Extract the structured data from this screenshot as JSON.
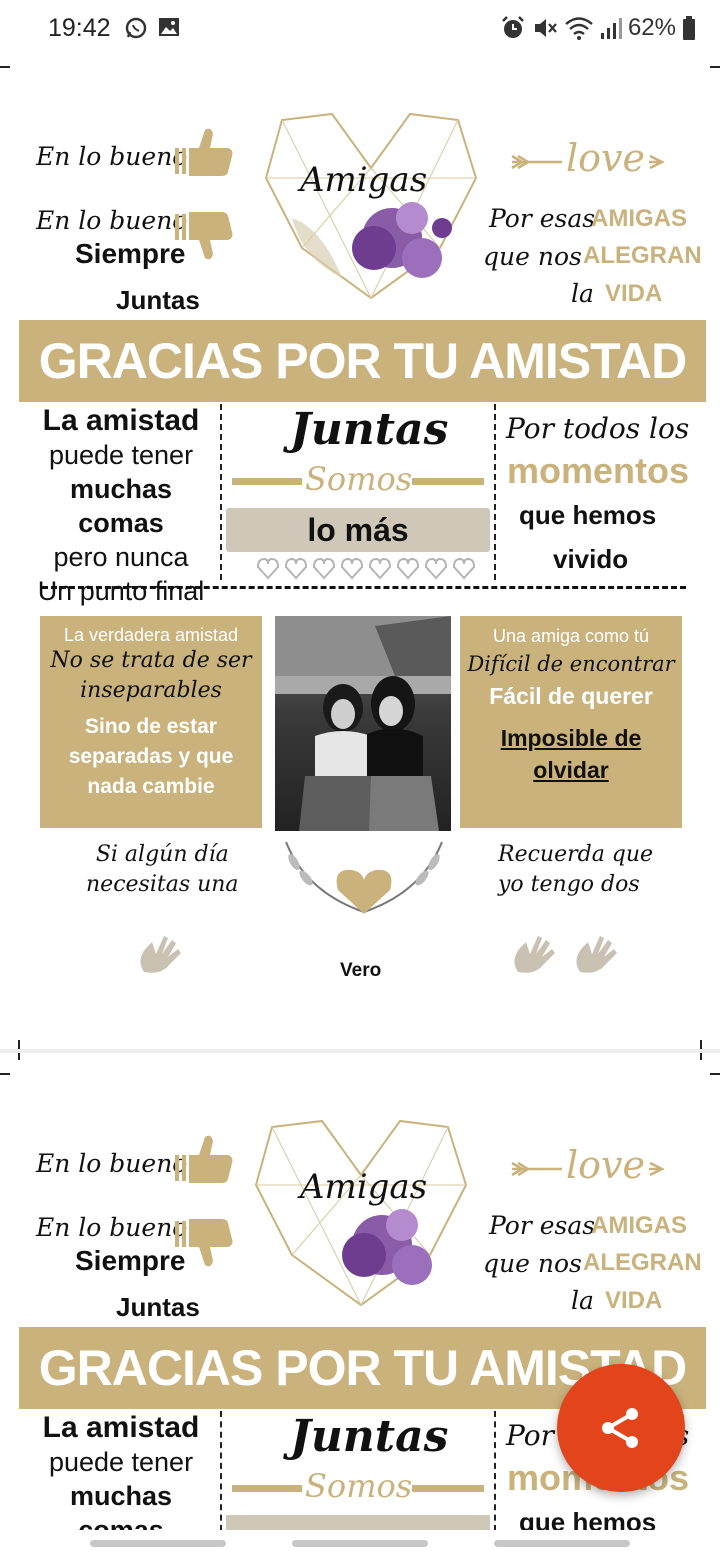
{
  "status_bar": {
    "time": "19:42",
    "battery": "62%",
    "left_icons": [
      "whatsapp-icon",
      "gallery-icon"
    ],
    "right_icons": [
      "alarm-icon",
      "mute-icon",
      "wifi-icon",
      "signal-icon",
      "battery-icon"
    ]
  },
  "poster": {
    "left_top": "En lo bueno",
    "left_mid": "En lo bueno",
    "siempre": "Siempre",
    "juntas_small": "Juntas",
    "heart_title": "Amigas",
    "love": "love",
    "por_esas": "Por esas",
    "amigas_caps": "AMIGAS",
    "que_nos": "que nos",
    "alegran": "ALEGRAN",
    "la": "la",
    "vida": "VIDA",
    "banner": "GRACIAS POR TU AMISTAD",
    "col1": [
      "La amistad",
      "puede tener",
      "muchas comas",
      "pero nunca",
      "Un punto final"
    ],
    "juntas_big": "Juntas",
    "somos": "Somos",
    "lo_mas": "lo más",
    "col3_line1": "Por todos los",
    "momentos": "momentos",
    "que_hemos": "que hemos",
    "vivido": "vivido",
    "box_left": [
      "La verdadera amistad",
      "No se trata de ser",
      "inseparables",
      "Sino de estar",
      "separadas y que",
      "nada cambie"
    ],
    "box_right": [
      "Una amiga como tú",
      "Difícil de encontrar",
      "Fácil de querer",
      "Imposible de",
      "olvidar"
    ],
    "si_algun": [
      "Si algún día",
      "necesitas una"
    ],
    "recuerda": [
      "Recuerda que",
      "yo tengo  dos"
    ],
    "name": "Vero"
  },
  "share_button": {
    "icon": "share-icon"
  },
  "colors": {
    "gold": "#c9b27c",
    "fab": "#e2451b"
  }
}
